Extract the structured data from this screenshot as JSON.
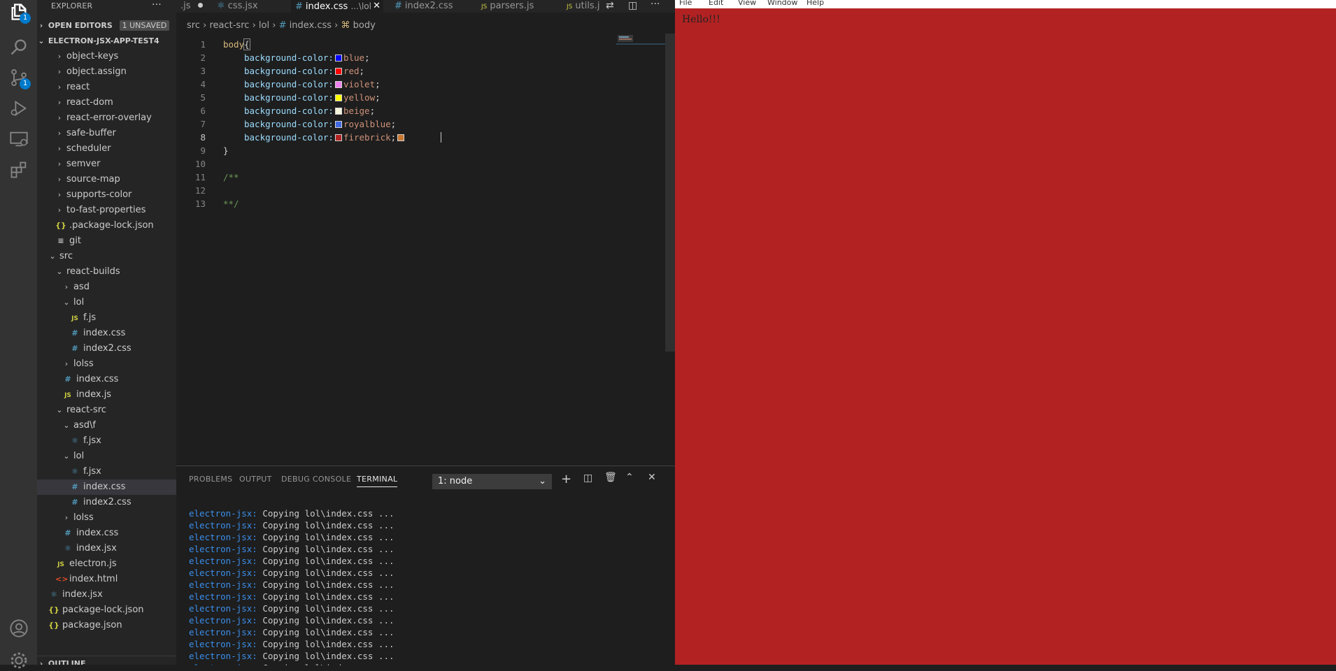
{
  "activity": {
    "explorer_badge": "1",
    "scm_badge": "1"
  },
  "sidebar": {
    "title": "EXPLORER",
    "open_editors": "OPEN EDITORS",
    "unsaved": "1 UNSAVED",
    "project": "ELECTRON-JSX-APP-TEST4",
    "outline": "OUTLINE",
    "items": [
      {
        "label": "object-keys",
        "chev": "›",
        "indent": 1,
        "icon": ""
      },
      {
        "label": "object.assign",
        "chev": "›",
        "indent": 1,
        "icon": ""
      },
      {
        "label": "react",
        "chev": "›",
        "indent": 1,
        "icon": ""
      },
      {
        "label": "react-dom",
        "chev": "›",
        "indent": 1,
        "icon": ""
      },
      {
        "label": "react-error-overlay",
        "chev": "›",
        "indent": 1,
        "icon": ""
      },
      {
        "label": "safe-buffer",
        "chev": "›",
        "indent": 1,
        "icon": ""
      },
      {
        "label": "scheduler",
        "chev": "›",
        "indent": 1,
        "icon": ""
      },
      {
        "label": "semver",
        "chev": "›",
        "indent": 1,
        "icon": ""
      },
      {
        "label": "source-map",
        "chev": "›",
        "indent": 1,
        "icon": ""
      },
      {
        "label": "supports-color",
        "chev": "›",
        "indent": 1,
        "icon": ""
      },
      {
        "label": "to-fast-properties",
        "chev": "›",
        "indent": 1,
        "icon": ""
      },
      {
        "label": ".package-lock.json",
        "chev": "",
        "indent": 1,
        "icon": "json"
      },
      {
        "label": "git",
        "chev": "",
        "indent": 1,
        "icon": "git"
      },
      {
        "label": "src",
        "chev": "⌄",
        "indent": 0,
        "icon": ""
      },
      {
        "label": "react-builds",
        "chev": "⌄",
        "indent": 1,
        "icon": ""
      },
      {
        "label": "asd",
        "chev": "›",
        "indent": 2,
        "icon": ""
      },
      {
        "label": "lol",
        "chev": "⌄",
        "indent": 2,
        "icon": ""
      },
      {
        "label": "f.js",
        "chev": "",
        "indent": 3,
        "icon": "js"
      },
      {
        "label": "index.css",
        "chev": "",
        "indent": 3,
        "icon": "css"
      },
      {
        "label": "index2.css",
        "chev": "",
        "indent": 3,
        "icon": "css"
      },
      {
        "label": "lolss",
        "chev": "›",
        "indent": 2,
        "icon": ""
      },
      {
        "label": "index.css",
        "chev": "",
        "indent": 2,
        "icon": "css"
      },
      {
        "label": "index.js",
        "chev": "",
        "indent": 2,
        "icon": "js"
      },
      {
        "label": "react-src",
        "chev": "⌄",
        "indent": 1,
        "icon": ""
      },
      {
        "label": "asd\\f",
        "chev": "⌄",
        "indent": 2,
        "icon": ""
      },
      {
        "label": "f.jsx",
        "chev": "",
        "indent": 3,
        "icon": "jsx"
      },
      {
        "label": "lol",
        "chev": "⌄",
        "indent": 2,
        "icon": ""
      },
      {
        "label": "f.jsx",
        "chev": "",
        "indent": 3,
        "icon": "jsx"
      },
      {
        "label": "index.css",
        "chev": "",
        "indent": 3,
        "icon": "css"
      },
      {
        "label": "index2.css",
        "chev": "",
        "indent": 3,
        "icon": "css"
      },
      {
        "label": "lolss",
        "chev": "›",
        "indent": 2,
        "icon": ""
      },
      {
        "label": "index.css",
        "chev": "",
        "indent": 2,
        "icon": "css"
      },
      {
        "label": "index.jsx",
        "chev": "",
        "indent": 2,
        "icon": "jsx"
      },
      {
        "label": "electron.js",
        "chev": "",
        "indent": 1,
        "icon": "js"
      },
      {
        "label": "index.html",
        "chev": "",
        "indent": 1,
        "icon": "html"
      },
      {
        "label": "index.jsx",
        "chev": "",
        "indent": 0,
        "icon": "jsx"
      },
      {
        "label": "package-lock.json",
        "chev": "",
        "indent": 0,
        "icon": "json"
      },
      {
        "label": "package.json",
        "chev": "",
        "indent": 0,
        "icon": "json"
      }
    ]
  },
  "tabs": {
    "t0": ".js",
    "t1": "css.jsx",
    "t2": "index.css",
    "t2_path": "...\\lol",
    "t3": "index2.css",
    "t4": "parsers.js",
    "t5": "utils.j"
  },
  "breadcrumb": {
    "c1": "src",
    "c2": "react-src",
    "c3": "lol",
    "c4": "index.css",
    "c5": "body"
  },
  "editor": {
    "lines": [
      {
        "n": "1",
        "t": "body{"
      },
      {
        "n": "2",
        "p": "background-color:",
        "v": "blue",
        "c": "#0000ff"
      },
      {
        "n": "3",
        "p": "background-color:",
        "v": "red",
        "c": "#ff0000"
      },
      {
        "n": "4",
        "p": "background-color:",
        "v": "violet",
        "c": "#ee82ee"
      },
      {
        "n": "5",
        "p": "background-color:",
        "v": "yellow",
        "c": "#ffff00"
      },
      {
        "n": "6",
        "p": "background-color:",
        "v": "beige",
        "c": "#f5f5dc"
      },
      {
        "n": "7",
        "p": "background-color:",
        "v": "royalblue",
        "c": "#4169e1"
      },
      {
        "n": "8",
        "p": "background-color:",
        "v": "firebrick",
        "c": "#b22222"
      },
      {
        "n": "9",
        "t": "}"
      },
      {
        "n": "10",
        "t": ""
      },
      {
        "n": "11",
        "t": "/**"
      },
      {
        "n": "12",
        "t": ""
      },
      {
        "n": "13",
        "t": "**/"
      }
    ]
  },
  "panel": {
    "problems": "PROBLEMS",
    "output": "OUTPUT",
    "debug": "DEBUG CONSOLE",
    "terminal": "TERMINAL",
    "terminal_select": "1: node",
    "prefix": "electron-jsx:",
    "message": " Copying lol\\index.css ...",
    "line_count": 14
  },
  "app": {
    "menu": [
      "File",
      "Edit",
      "View",
      "Window",
      "Help"
    ],
    "text": "Hello!!!",
    "bg": "#b22222"
  }
}
